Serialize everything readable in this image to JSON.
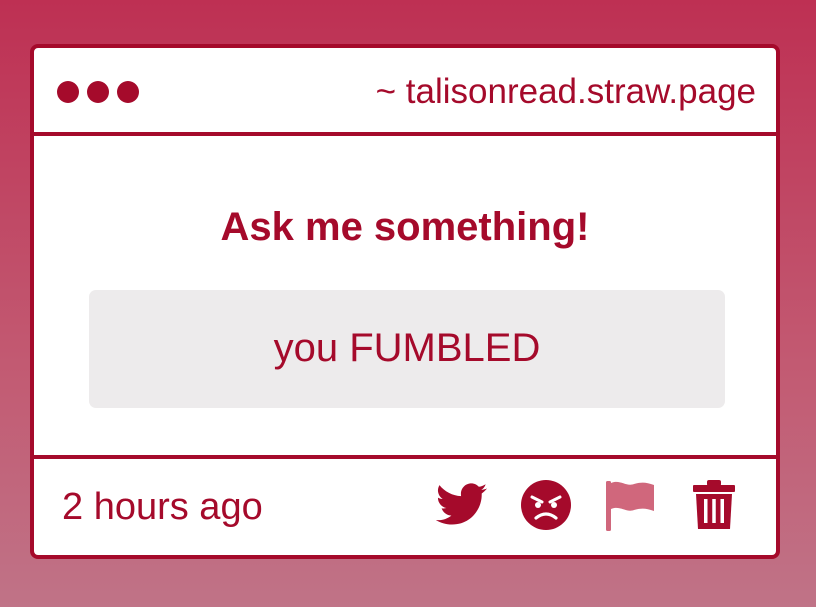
{
  "window": {
    "url": "~ talisonread.straw.page"
  },
  "main": {
    "heading": "Ask me something!",
    "answer": "you FUMBLED"
  },
  "footer": {
    "timestamp": "2 hours ago",
    "actions": [
      {
        "icon": "twitter-icon"
      },
      {
        "icon": "angry-face-icon"
      },
      {
        "icon": "flag-icon"
      },
      {
        "icon": "trash-icon"
      }
    ]
  },
  "colors": {
    "accent": "#a50a2b",
    "flag": "#d0677c",
    "answer_bg": "#edebec",
    "background_top": "#be3053",
    "background_bottom": "#c07387"
  }
}
